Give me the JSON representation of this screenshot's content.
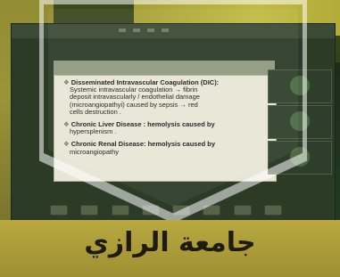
{
  "slide": {
    "items": [
      {
        "title": "Disseminated Intravascular Coagulation (DIC):",
        "lines": [
          "Systemic intravascular coagulation → fibrin",
          "deposit intravascularly / endothelial damage",
          "(microangiopathyi) caused by sepsis → red",
          "cells destruction ."
        ]
      },
      {
        "title": "Chronic Liver Disease : hemolysis caused by",
        "lines": [
          "hypersplenism ."
        ]
      },
      {
        "title": "Chronic Renal Disease: hemolysis caused by",
        "lines": [
          "microangiopathy"
        ]
      }
    ]
  },
  "logo": {
    "text": "جامعة الرازي"
  },
  "colors": {
    "slide_bg": "#e8e6d6",
    "logo_bar": "#b9a93f",
    "meeting_bg": "#2b3b26"
  },
  "icons": [
    "chevron-down-icon"
  ]
}
